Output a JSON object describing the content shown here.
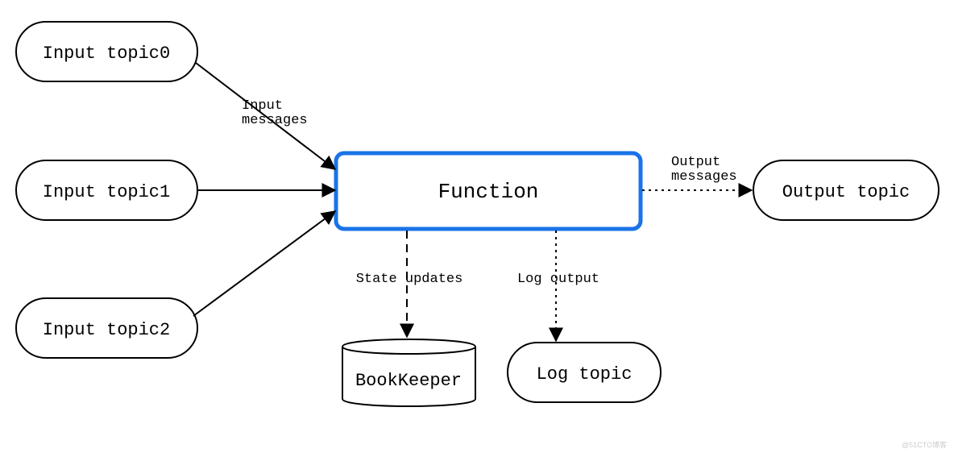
{
  "nodes": {
    "input0": "Input topic0",
    "input1": "Input topic1",
    "input2": "Input topic2",
    "function": "Function",
    "bookkeeper": "BookKeeper",
    "logtopic": "Log topic",
    "outputtopic": "Output topic"
  },
  "labels": {
    "inputMessages": "Input\nmessages",
    "stateUpdates": "State updates",
    "logOutput": "Log output",
    "outputMessages": "Output\nmessages"
  },
  "watermark": "@51CTO博客"
}
